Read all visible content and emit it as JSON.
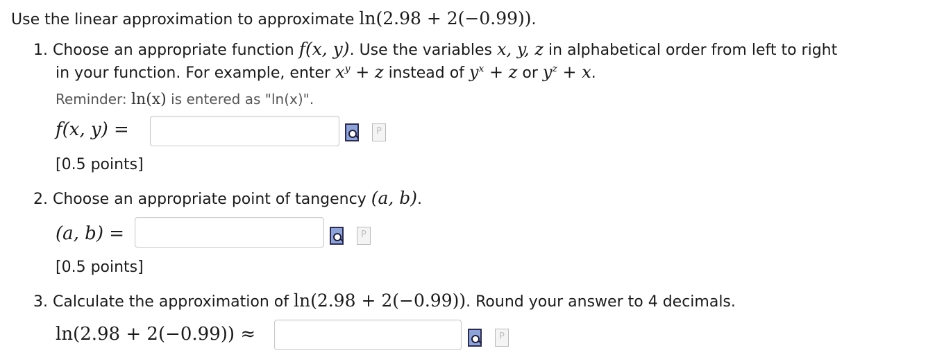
{
  "intro": {
    "prefix": "Use the linear approximation to approximate ",
    "expr": "ln(2.98 + 2(−0.99))",
    "suffix": "."
  },
  "q1": {
    "number": "1.",
    "part1": "Choose an appropriate function ",
    "func": "f(x, y)",
    "part2": ". Use the variables ",
    "vars": "x, y, z",
    "part3": " in alphabetical order from left to right",
    "line2_a": "in your function. For example, enter ",
    "ex_base": "x",
    "ex_sup": "y",
    "ex_plus": " + z",
    "line2_b": " instead of ",
    "alt1_base": "y",
    "alt1_sup": "x",
    "alt1_plus": " + z",
    "or": " or ",
    "alt2_base": "y",
    "alt2_sup": "z",
    "alt2_plus": " + x",
    "end": ".",
    "reminder_a": "Reminder: ",
    "reminder_math": "ln(x)",
    "reminder_b": " is entered as \"ln(x)\".",
    "label": "f(x, y) =",
    "input_value": "",
    "points": "[0.5 points]"
  },
  "q2": {
    "number": "2.",
    "text": "Choose an appropriate point of tangency ",
    "math": "(a, b)",
    "end": ".",
    "label": "(a, b) =",
    "input_value": "",
    "points": "[0.5 points]"
  },
  "q3": {
    "number": "3.",
    "text": "Calculate the approximation of ",
    "math": "ln(2.98 + 2(−0.99))",
    "text2": ". Round your answer to 4 decimals.",
    "label": "ln(2.98 + 2(−0.99)) ≈",
    "input_value": ""
  },
  "icons": {
    "preview": "preview-icon",
    "help": "syntax-help-icon"
  }
}
